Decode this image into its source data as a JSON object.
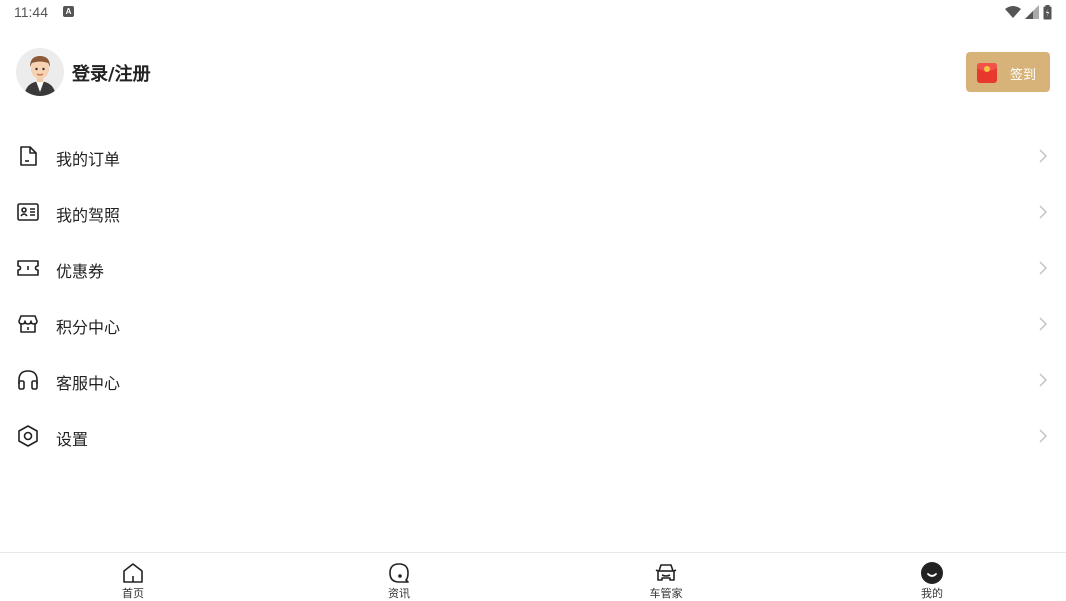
{
  "status_bar": {
    "time": "11:44",
    "notification_letter": "A"
  },
  "profile": {
    "login_label": "登录/注册",
    "sign_in_label": "签到"
  },
  "menu": {
    "items": [
      {
        "label": "我的订单",
        "icon": "document-icon"
      },
      {
        "label": "我的驾照",
        "icon": "id-card-icon"
      },
      {
        "label": "优惠券",
        "icon": "ticket-icon"
      },
      {
        "label": "积分中心",
        "icon": "store-icon"
      },
      {
        "label": "客服中心",
        "icon": "headphones-icon"
      },
      {
        "label": "设置",
        "icon": "settings-icon"
      }
    ]
  },
  "tabbar": {
    "tabs": [
      {
        "label": "首页",
        "icon": "home-icon"
      },
      {
        "label": "资讯",
        "icon": "news-icon"
      },
      {
        "label": "车管家",
        "icon": "car-icon"
      },
      {
        "label": "我的",
        "icon": "profile-icon",
        "active": true
      }
    ]
  },
  "colors": {
    "accent_gold": "#d7b37a",
    "text": "#222222",
    "divider": "#e8e8e8"
  }
}
